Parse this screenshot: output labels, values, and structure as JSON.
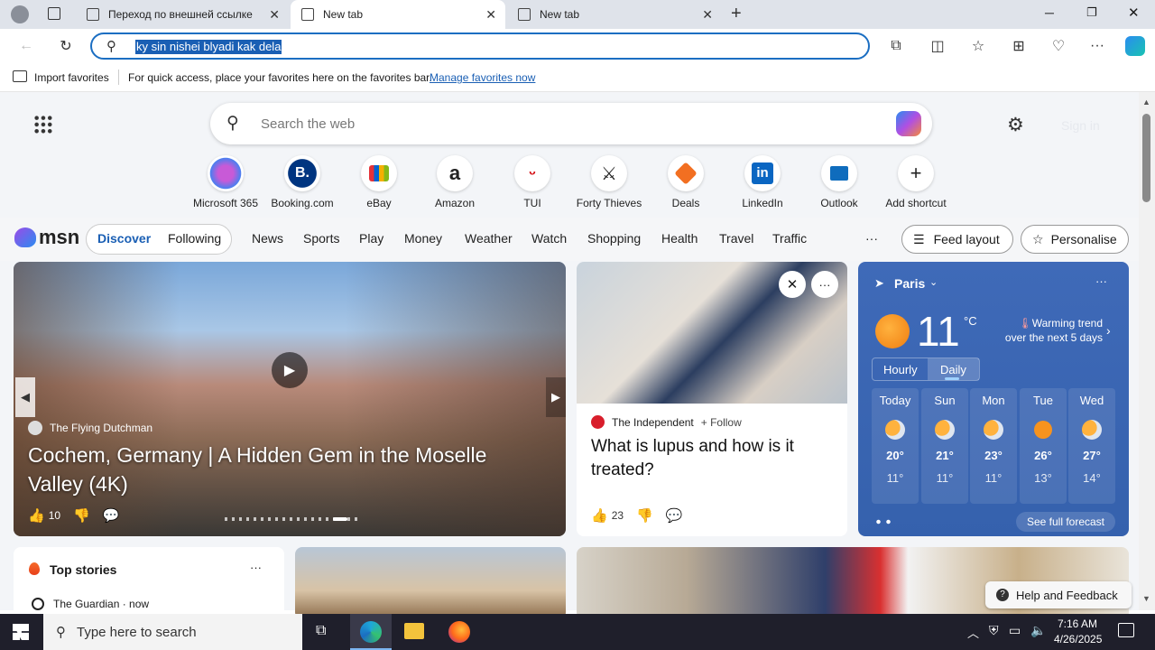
{
  "tabs": [
    {
      "title": "Переход по внешней ссылке"
    },
    {
      "title": "New tab"
    },
    {
      "title": "New tab"
    }
  ],
  "address": {
    "value": "ky sin nishei blyadi kak dela"
  },
  "favorites_bar": {
    "import_label": "Import favorites",
    "hint": "For quick access, place your favorites here on the favorites bar.",
    "manage_link": "Manage favorites now"
  },
  "search": {
    "placeholder": "Search the web"
  },
  "sign_in": "Sign in",
  "shortcuts": [
    {
      "label": "Microsoft 365",
      "icon": "m365-icon"
    },
    {
      "label": "Booking.com",
      "icon": "B."
    },
    {
      "label": "eBay",
      "icon": "ebay-icon"
    },
    {
      "label": "Amazon",
      "icon": "a"
    },
    {
      "label": "TUI",
      "icon": "tui-icon"
    },
    {
      "label": "Forty Thieves",
      "icon": "swords-icon"
    },
    {
      "label": "Deals",
      "icon": "tag-icon"
    },
    {
      "label": "LinkedIn",
      "icon": "in"
    },
    {
      "label": "Outlook",
      "icon": "outlook-icon"
    },
    {
      "label": "Add shortcut",
      "icon": "+"
    }
  ],
  "msn": {
    "logo": "msn",
    "pills": [
      "Discover",
      "Following"
    ],
    "nav": [
      "News",
      "Sports",
      "Play",
      "Money",
      "Weather",
      "Watch",
      "Shopping",
      "Health",
      "Travel",
      "Traffic"
    ],
    "more": "···",
    "feed_layout": "Feed layout",
    "personalise": "Personalise"
  },
  "hero": {
    "source": "The Flying Dutchman",
    "title": "Cochem, Germany | A Hidden Gem in the Moselle Valley (4K)",
    "likes": "10"
  },
  "article": {
    "source": "The Independent",
    "follow": "+ Follow",
    "title": "What is lupus and how is it treated?",
    "likes": "23"
  },
  "weather": {
    "city": "Paris",
    "temp": "11",
    "unit": "°C",
    "trend": "Warming trend over the next 5 days",
    "tabs": [
      "Hourly",
      "Daily"
    ],
    "days": [
      {
        "name": "Today",
        "hi": "20°",
        "lo": "11°"
      },
      {
        "name": "Sun",
        "hi": "21°",
        "lo": "11°"
      },
      {
        "name": "Mon",
        "hi": "23°",
        "lo": "11°"
      },
      {
        "name": "Tue",
        "hi": "26°",
        "lo": "13°"
      },
      {
        "name": "Wed",
        "hi": "27°",
        "lo": "14°"
      }
    ],
    "see_full": "See full forecast"
  },
  "top_stories": {
    "title": "Top stories",
    "first_source": "The Guardian · now"
  },
  "help": "Help and Feedback",
  "taskbar": {
    "search_placeholder": "Type here to search",
    "time": "7:16 AM",
    "date": "4/26/2025"
  },
  "colors": {
    "accent": "#1b6ec2",
    "weather_bg": "#3f6ab8",
    "taskbar": "#1f1f2b"
  }
}
